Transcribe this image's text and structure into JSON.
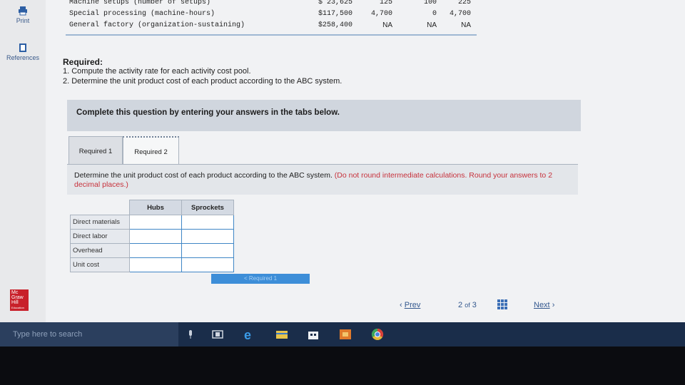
{
  "sidebar": {
    "print_label": "Print",
    "references_label": "References",
    "logo_text": [
      "Mc",
      "Graw",
      "Hill",
      "Education"
    ]
  },
  "data_table": {
    "rows": [
      {
        "label": "Machine setups (number of setups)",
        "total": "$ 23,625",
        "a": "125",
        "b": "100",
        "c": "225"
      },
      {
        "label": "Special processing (machine-hours)",
        "total": "$117,500",
        "a": "4,700",
        "b": "0",
        "c": "4,700"
      },
      {
        "label": "General factory (organization-sustaining)",
        "total": "$258,400",
        "a": "NA",
        "b": "NA",
        "c": "NA"
      }
    ]
  },
  "required": {
    "title": "Required:",
    "items": [
      "1. Compute the activity rate for each activity cost pool.",
      "2. Determine the unit product cost of each product according to the ABC system."
    ]
  },
  "banner": "Complete this question by entering your answers in the tabs below.",
  "tabs": [
    "Required 1",
    "Required 2"
  ],
  "instruction": {
    "main": "Determine the unit product cost of each product according to the ABC system.",
    "note": "(Do not round intermediate calculations. Round your answers to 2 decimal places.)"
  },
  "answer_table": {
    "columns": [
      "Hubs",
      "Sprockets"
    ],
    "rows": [
      "Direct materials",
      "Direct labor",
      "Overhead",
      "Unit cost"
    ]
  },
  "next_tab_button": "< Required 1",
  "pagination": {
    "prev": "Prev",
    "page": "2",
    "of": "of",
    "total": "3",
    "next": "Next"
  },
  "taskbar": {
    "search_placeholder": "Type here to search"
  }
}
